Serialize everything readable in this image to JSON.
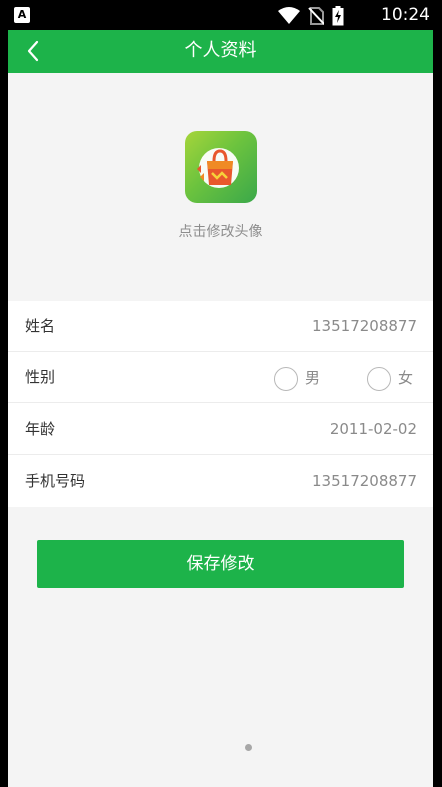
{
  "status_bar": {
    "left_badge": "A",
    "time": "10:24",
    "icons": [
      "wifi-icon",
      "no-sim-icon",
      "battery-charging-icon"
    ]
  },
  "header": {
    "title": "个人资料",
    "back_icon": "chevron-left-icon"
  },
  "avatar": {
    "hint": "点击修改头像",
    "icon": "shopping-bag-logo"
  },
  "form": {
    "name": {
      "label": "姓名",
      "value": "13517208877"
    },
    "gender": {
      "label": "性别",
      "options": [
        "男",
        "女"
      ],
      "selected": null
    },
    "age": {
      "label": "年龄",
      "value": "2011-02-02"
    },
    "phone": {
      "label": "手机号码",
      "value": "13517208877"
    }
  },
  "actions": {
    "save_label": "保存修改"
  },
  "colors": {
    "primary": "#1db34a",
    "background": "#f4f4f4"
  }
}
